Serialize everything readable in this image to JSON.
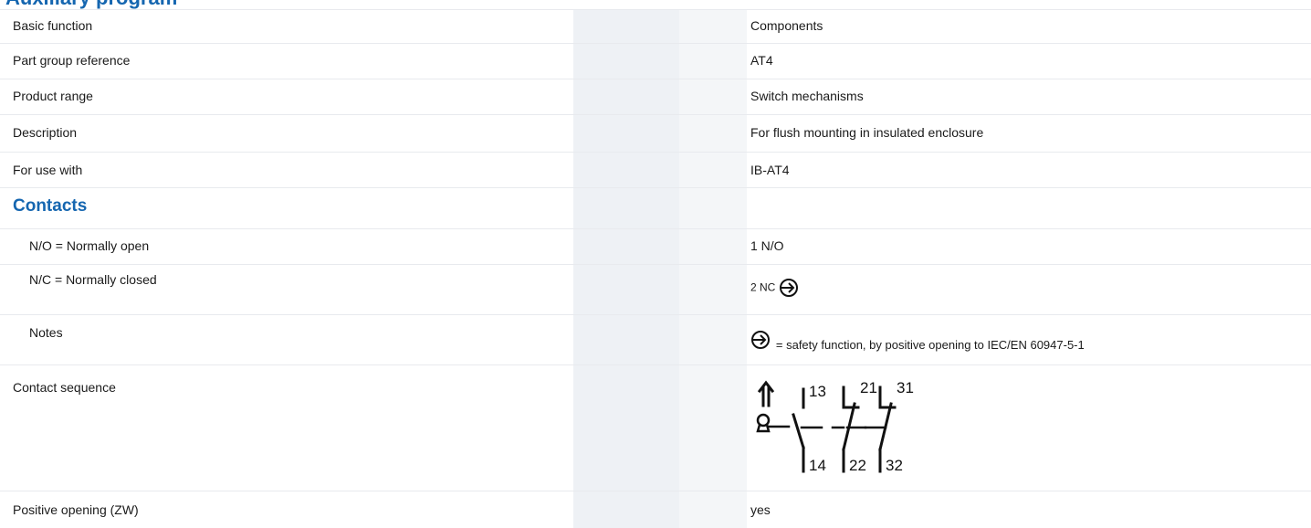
{
  "page": {
    "heading": "Auxiliary program"
  },
  "rows": [
    {
      "label": "Basic function",
      "value": "Components"
    },
    {
      "label": "Part group reference",
      "value": "AT4"
    },
    {
      "label": "Product range",
      "value": "Switch mechanisms"
    },
    {
      "label": "Description",
      "value": "For flush mounting in insulated enclosure"
    },
    {
      "label": "For use with",
      "value": "IB-AT4"
    }
  ],
  "contacts": {
    "title": "Contacts",
    "no_label": "N/O = Normally open",
    "no_value": "1 N/O",
    "nc_label": "N/C = Normally closed",
    "nc_value": "2 NC",
    "notes_label": "Notes",
    "notes_value": "= safety function, by positive opening to IEC/EN 60947-5-1"
  },
  "sequence": {
    "label": "Contact sequence",
    "terminals": [
      "13",
      "21",
      "31",
      "14",
      "22",
      "32"
    ]
  },
  "positive": {
    "label": "Positive opening (ZW)",
    "value": "yes"
  },
  "icons": {
    "positive_opening": "positive-opening-icon"
  },
  "colors": {
    "heading": "#1566b0",
    "column_shade": "#eef1f5",
    "divider": "#e8eaee"
  }
}
